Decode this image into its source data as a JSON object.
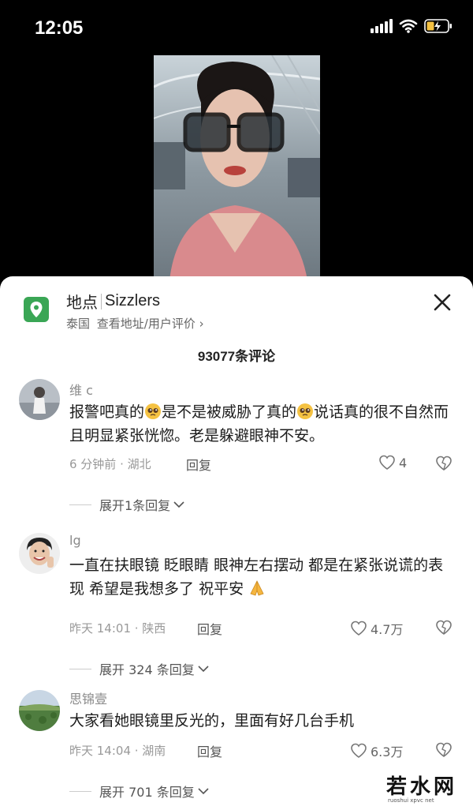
{
  "status_bar": {
    "time": "12:05",
    "icons": [
      "signal-icon",
      "wifi-icon",
      "battery-charging-icon"
    ]
  },
  "video": {
    "description_icon": "video-frame"
  },
  "location": {
    "label": "地点",
    "name": "Sizzlers",
    "region": "泰国",
    "link_text": "查看地址/用户评价",
    "chevron": "›",
    "icon": "location-pin-icon",
    "close_icon": "close-icon"
  },
  "comments": {
    "count_text": "93077条评论",
    "items": [
      {
        "username": "维 c",
        "text_parts": [
          "报警吧真的",
          "是不是被威胁了真的",
          "说话真的很不自然而且明显紧张恍惚。老是躲避眼神不安。"
        ],
        "emoji": "pleading-face-emoji",
        "meta": "6 分钟前 · 湖北",
        "reply": "回复",
        "likes": "4",
        "expand": "展开1条回复"
      },
      {
        "username": "lg",
        "text": "一直在扶眼镜 眨眼睛 眼神左右摆动 都是在紧张说谎的表现 希望是我想多了 祝平安",
        "emoji": "folded-hands-emoji",
        "meta": "昨天 14:01 · 陕西",
        "reply": "回复",
        "likes": "4.7万",
        "expand": "展开 324 条回复"
      },
      {
        "username": "思锦壹",
        "text": "大家看她眼镜里反光的，里面有好几台手机",
        "meta": "昨天 14:04 · 湖南",
        "reply": "回复",
        "likes": "6.3万",
        "expand": "展开 701 条回复"
      }
    ]
  },
  "watermark": {
    "text": "若水网",
    "sub": "ruoshui  xpvc  net"
  },
  "colors": {
    "accent_green": "#3aa655",
    "background_dark": "#000000",
    "sheet": "#ffffff"
  }
}
